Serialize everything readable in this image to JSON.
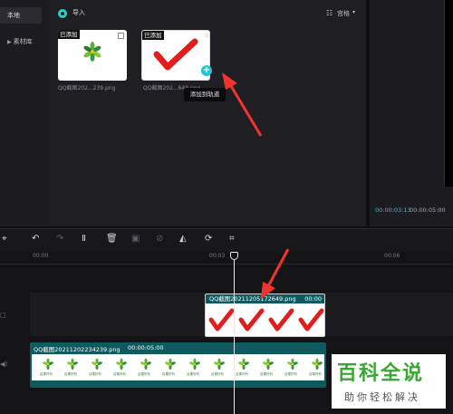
{
  "sidebar": {
    "items": [
      {
        "label": "本地"
      },
      {
        "label": "素材库"
      }
    ]
  },
  "media": {
    "import_label": "导入",
    "view_label": "宫格",
    "cards": [
      {
        "badge": "已添加",
        "caption": "QQ截图202...239.png"
      },
      {
        "badge": "已添加",
        "caption": "QQ截图202...649.png",
        "edge_text": "8"
      }
    ],
    "tooltip": "添加到轨道"
  },
  "preview": {
    "time_current": "00:00:03:13",
    "time_total": "00:00:05:00"
  },
  "ruler": {
    "labels": [
      "00:00",
      "00:03",
      "00:06"
    ]
  },
  "timeline": {
    "clip_top": {
      "name": "QQ截图20211205172649.png",
      "duration": "00:00"
    },
    "clip_bottom": {
      "name": "QQ截图20211202234239.png",
      "duration": "00:00:05:00",
      "logo_text": "百果好利"
    }
  },
  "watermark": {
    "title": "百科全说",
    "subtitle": "助你轻松解决"
  },
  "colors": {
    "accent": "#27d3c6",
    "clip_teal": "#0e5a5e",
    "check_red": "#e01e1e",
    "arrow_red": "#f2332e"
  }
}
